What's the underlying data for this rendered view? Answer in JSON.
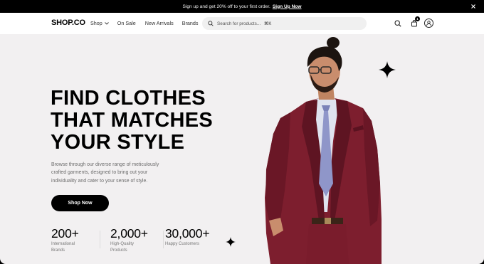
{
  "promo": {
    "text": "Sign up and get 20% off to your first order.",
    "link": "Sign Up Now"
  },
  "nav": {
    "logo": "SHOP.CO",
    "links": [
      "Shop",
      "On Sale",
      "New Arrivals",
      "Brands"
    ],
    "search_placeholder": "Search for products...",
    "search_shortcut": "⌘K",
    "cart_count": "1"
  },
  "hero": {
    "headline": [
      "FIND CLOTHES",
      "THAT MATCHES",
      "YOUR STYLE"
    ],
    "description": "Browse through our diverse range of meticulously crafted garments, designed to bring out your individuality and cater to your sense of style.",
    "cta": "Shop Now",
    "stats": [
      {
        "value": "200+",
        "label_1": "International",
        "label_2": "Brands"
      },
      {
        "value": "2,000+",
        "label_1": "High-Quality",
        "label_2": "Products"
      },
      {
        "value": "30,000+",
        "label_1": "Happy Customers",
        "label_2": ""
      }
    ]
  },
  "colors": {
    "background": "#f2f0f1",
    "accent": "#000000",
    "suit": "#7d1e2e"
  }
}
